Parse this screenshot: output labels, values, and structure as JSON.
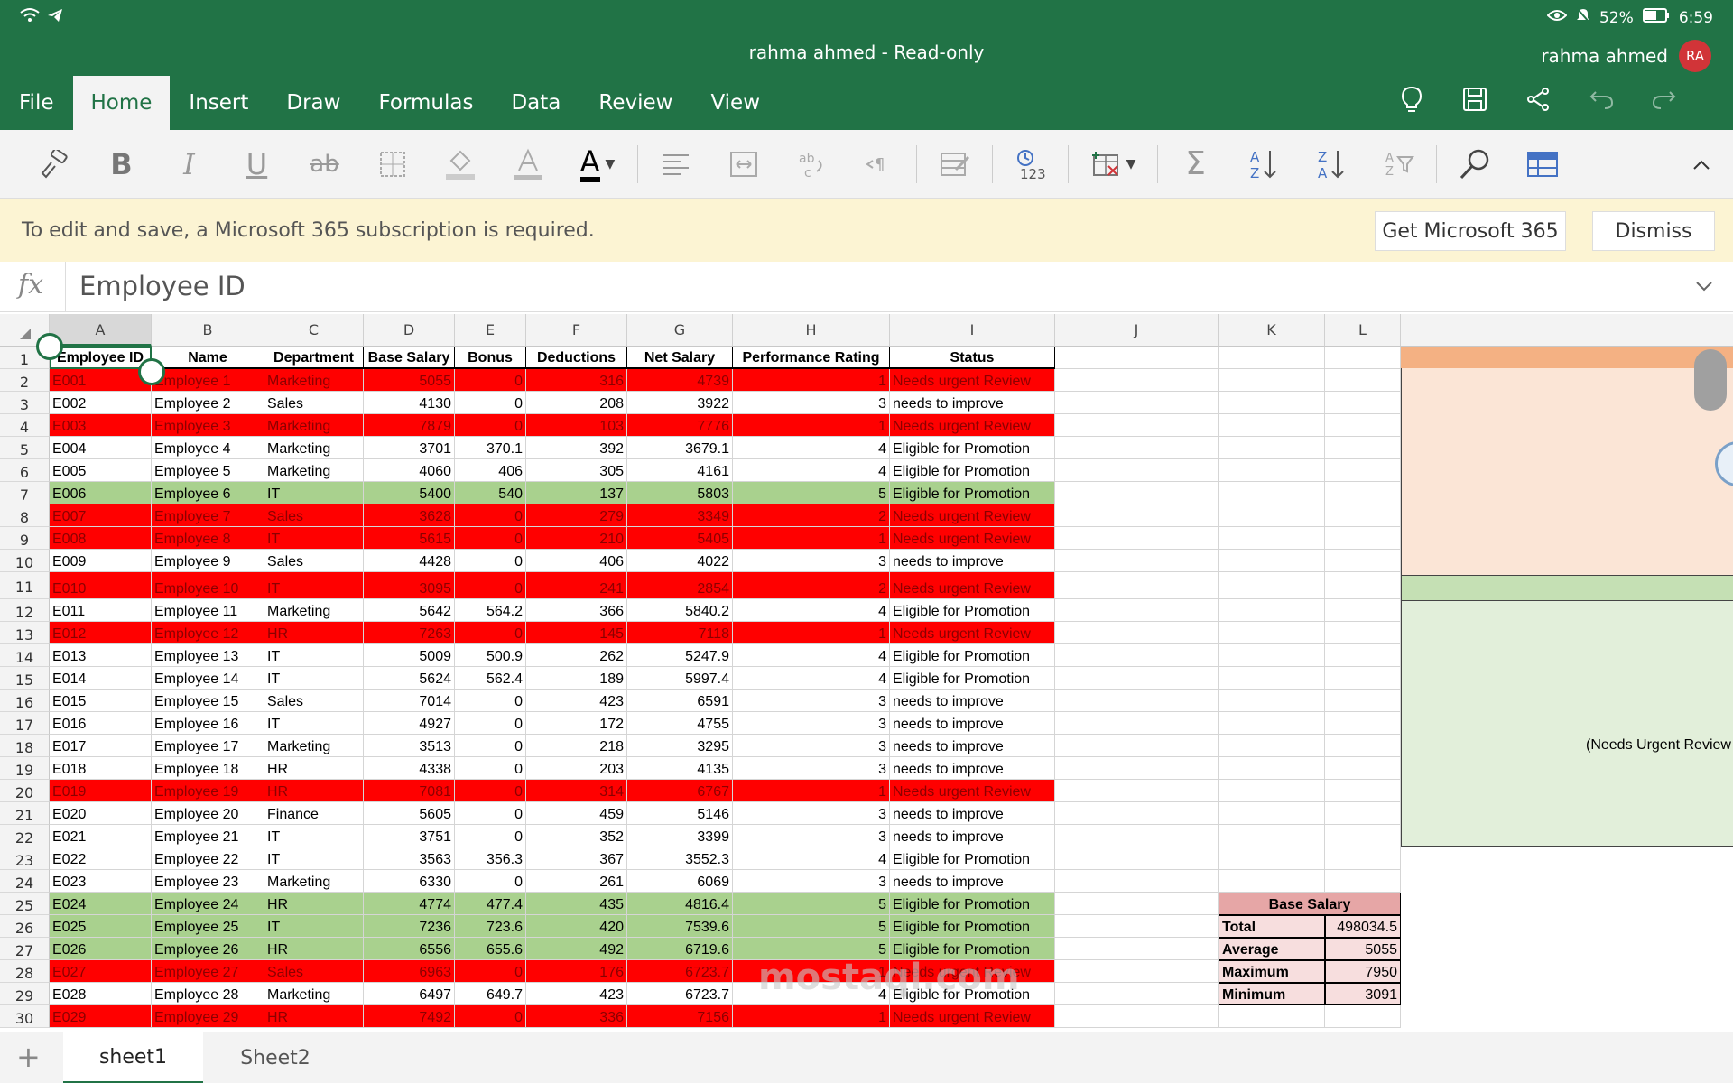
{
  "status_bar": {
    "battery": "52%",
    "time": "6:59"
  },
  "window": {
    "title": "rahma ahmed - Read-only",
    "user": "rahma ahmed",
    "avatar_initials": "RA"
  },
  "tabs": [
    "File",
    "Home",
    "Insert",
    "Draw",
    "Formulas",
    "Data",
    "Review",
    "View"
  ],
  "active_tab": "Home",
  "ribbon": {
    "bold": "B",
    "italic": "I",
    "underline": "U",
    "strikethrough": "ab",
    "font_color": "A",
    "number_format": "123"
  },
  "notice": {
    "message": "To edit and save, a Microsoft 365 subscription is required.",
    "get_button": "Get Microsoft 365",
    "dismiss_button": "Dismiss"
  },
  "formula_bar": {
    "fx": "fx",
    "value": "Employee ID"
  },
  "columns": [
    "A",
    "B",
    "C",
    "D",
    "E",
    "F",
    "G",
    "H",
    "I",
    "J",
    "K",
    "L"
  ],
  "headers": [
    "Employee ID",
    "Name",
    "Department",
    "Base Salary",
    "Bonus",
    "Deductions",
    "Net Salary",
    "Performance Rating",
    "Status"
  ],
  "rows": [
    [
      "E001",
      "Employee 1",
      "Marketing",
      "5055",
      "0",
      "316",
      "4739",
      "1",
      "Needs urgent Review"
    ],
    [
      "E002",
      "Employee 2",
      "Sales",
      "4130",
      "0",
      "208",
      "3922",
      "3",
      "needs to improve"
    ],
    [
      "E003",
      "Employee 3",
      "Marketing",
      "7879",
      "0",
      "103",
      "7776",
      "1",
      "Needs urgent Review"
    ],
    [
      "E004",
      "Employee 4",
      "Marketing",
      "3701",
      "370.1",
      "392",
      "3679.1",
      "4",
      "Eligible for Promotion"
    ],
    [
      "E005",
      "Employee 5",
      "Marketing",
      "4060",
      "406",
      "305",
      "4161",
      "4",
      "Eligible for Promotion"
    ],
    [
      "E006",
      "Employee 6",
      "IT",
      "5400",
      "540",
      "137",
      "5803",
      "5",
      "Eligible for Promotion"
    ],
    [
      "E007",
      "Employee 7",
      "Sales",
      "3628",
      "0",
      "279",
      "3349",
      "2",
      "Needs urgent Review"
    ],
    [
      "E008",
      "Employee 8",
      "IT",
      "5615",
      "0",
      "210",
      "5405",
      "1",
      "Needs urgent Review"
    ],
    [
      "E009",
      "Employee 9",
      "Sales",
      "4428",
      "0",
      "406",
      "4022",
      "3",
      "needs to improve"
    ],
    [
      "E010",
      "Employee 10",
      "IT",
      "3095",
      "0",
      "241",
      "2854",
      "2",
      "Needs urgent Review"
    ],
    [
      "E011",
      "Employee 11",
      "Marketing",
      "5642",
      "564.2",
      "366",
      "5840.2",
      "4",
      "Eligible for Promotion"
    ],
    [
      "E012",
      "Employee 12",
      "HR",
      "7263",
      "0",
      "145",
      "7118",
      "1",
      "Needs urgent Review"
    ],
    [
      "E013",
      "Employee 13",
      "IT",
      "5009",
      "500.9",
      "262",
      "5247.9",
      "4",
      "Eligible for Promotion"
    ],
    [
      "E014",
      "Employee 14",
      "IT",
      "5624",
      "562.4",
      "189",
      "5997.4",
      "4",
      "Eligible for Promotion"
    ],
    [
      "E015",
      "Employee 15",
      "Sales",
      "7014",
      "0",
      "423",
      "6591",
      "3",
      "needs to improve"
    ],
    [
      "E016",
      "Employee 16",
      "IT",
      "4927",
      "0",
      "172",
      "4755",
      "3",
      "needs to improve"
    ],
    [
      "E017",
      "Employee 17",
      "Marketing",
      "3513",
      "0",
      "218",
      "3295",
      "3",
      "needs to improve"
    ],
    [
      "E018",
      "Employee 18",
      "HR",
      "4338",
      "0",
      "203",
      "4135",
      "3",
      "needs to improve"
    ],
    [
      "E019",
      "Employee 19",
      "HR",
      "7081",
      "0",
      "314",
      "6767",
      "1",
      "Needs urgent Review"
    ],
    [
      "E020",
      "Employee 20",
      "Finance",
      "5605",
      "0",
      "459",
      "5146",
      "3",
      "needs to improve"
    ],
    [
      "E021",
      "Employee 21",
      "IT",
      "3751",
      "0",
      "352",
      "3399",
      "3",
      "needs to improve"
    ],
    [
      "E022",
      "Employee 22",
      "IT",
      "3563",
      "356.3",
      "367",
      "3552.3",
      "4",
      "Eligible for Promotion"
    ],
    [
      "E023",
      "Employee 23",
      "Marketing",
      "6330",
      "0",
      "261",
      "6069",
      "3",
      "needs to improve"
    ],
    [
      "E024",
      "Employee 24",
      "HR",
      "4774",
      "477.4",
      "435",
      "4816.4",
      "5",
      "Eligible for Promotion"
    ],
    [
      "E025",
      "Employee 25",
      "IT",
      "7236",
      "723.6",
      "420",
      "7539.6",
      "5",
      "Eligible for Promotion"
    ],
    [
      "E026",
      "Employee 26",
      "HR",
      "6556",
      "655.6",
      "492",
      "6719.6",
      "5",
      "Eligible for Promotion"
    ],
    [
      "E027",
      "Employee 27",
      "Sales",
      "6963",
      "0",
      "176",
      "6723.7",
      "1",
      "Needs urgent Review"
    ],
    [
      "E028",
      "Employee 28",
      "Marketing",
      "6497",
      "649.7",
      "423",
      "6723.7",
      "4",
      "Eligible for Promotion"
    ],
    [
      "E029",
      "Employee 29",
      "HR",
      "7492",
      "0",
      "336",
      "7156",
      "1",
      "Needs urgent Review"
    ]
  ],
  "row_fill": [
    "red",
    "",
    "red",
    "",
    "",
    "green",
    "red",
    "red",
    "",
    "red",
    "",
    "red",
    "",
    "",
    "",
    "",
    "",
    "",
    "red",
    "",
    "",
    "",
    "",
    "green",
    "green",
    "green",
    "red",
    "",
    "red"
  ],
  "stats": {
    "title": "Base Salary",
    "items": [
      [
        "Total",
        "498034.5"
      ],
      [
        "Average",
        "5055"
      ],
      [
        "Maximum",
        "7950"
      ],
      [
        "Minimum",
        "3091"
      ]
    ]
  },
  "side_label": "(Needs Urgent Review",
  "sheets": [
    "sheet1",
    "Sheet2"
  ],
  "watermark": "mostaql.com",
  "colors": {
    "excel_green": "#217346",
    "red": "#ff0000",
    "green_fill": "#a9d18e",
    "notice": "#fcf4d3"
  }
}
